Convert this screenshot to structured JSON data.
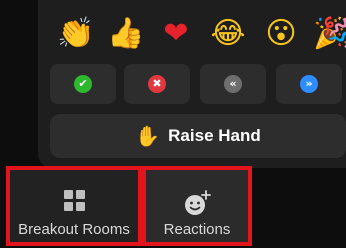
{
  "reactions_popup": {
    "emojis": [
      {
        "icon": "clapping-hands-icon",
        "glyph": "👏"
      },
      {
        "icon": "thumbs-up-icon",
        "glyph": "👍"
      },
      {
        "icon": "red-heart-icon",
        "glyph": "❤"
      },
      {
        "icon": "tears-of-joy-icon",
        "glyph": "😂"
      },
      {
        "icon": "surprised-face-icon",
        "glyph": "😮"
      },
      {
        "icon": "party-popper-icon",
        "glyph": "🎉"
      }
    ],
    "feedback_buttons": [
      {
        "icon": "yes-check-icon",
        "glyph": "✔",
        "color": "#2eb82e"
      },
      {
        "icon": "no-x-icon",
        "glyph": "✖",
        "color": "#e0383e"
      },
      {
        "icon": "slow-down-icon",
        "glyph": "«",
        "color": "#6e6e6e"
      },
      {
        "icon": "speed-up-icon",
        "glyph": "»",
        "color": "#2d8cff"
      }
    ],
    "raise_hand": {
      "icon": "raised-hand-icon",
      "glyph": "✋",
      "label": "Raise Hand"
    }
  },
  "toolbar": {
    "breakout_rooms": {
      "icon": "grid-icon",
      "label": "Breakout Rooms"
    },
    "reactions": {
      "icon": "add-reaction-icon",
      "label": "Reactions"
    }
  },
  "colors": {
    "highlight_border": "#e3141b",
    "panel_bg": "#1e1e1e",
    "button_bg": "#2d2d2d"
  }
}
